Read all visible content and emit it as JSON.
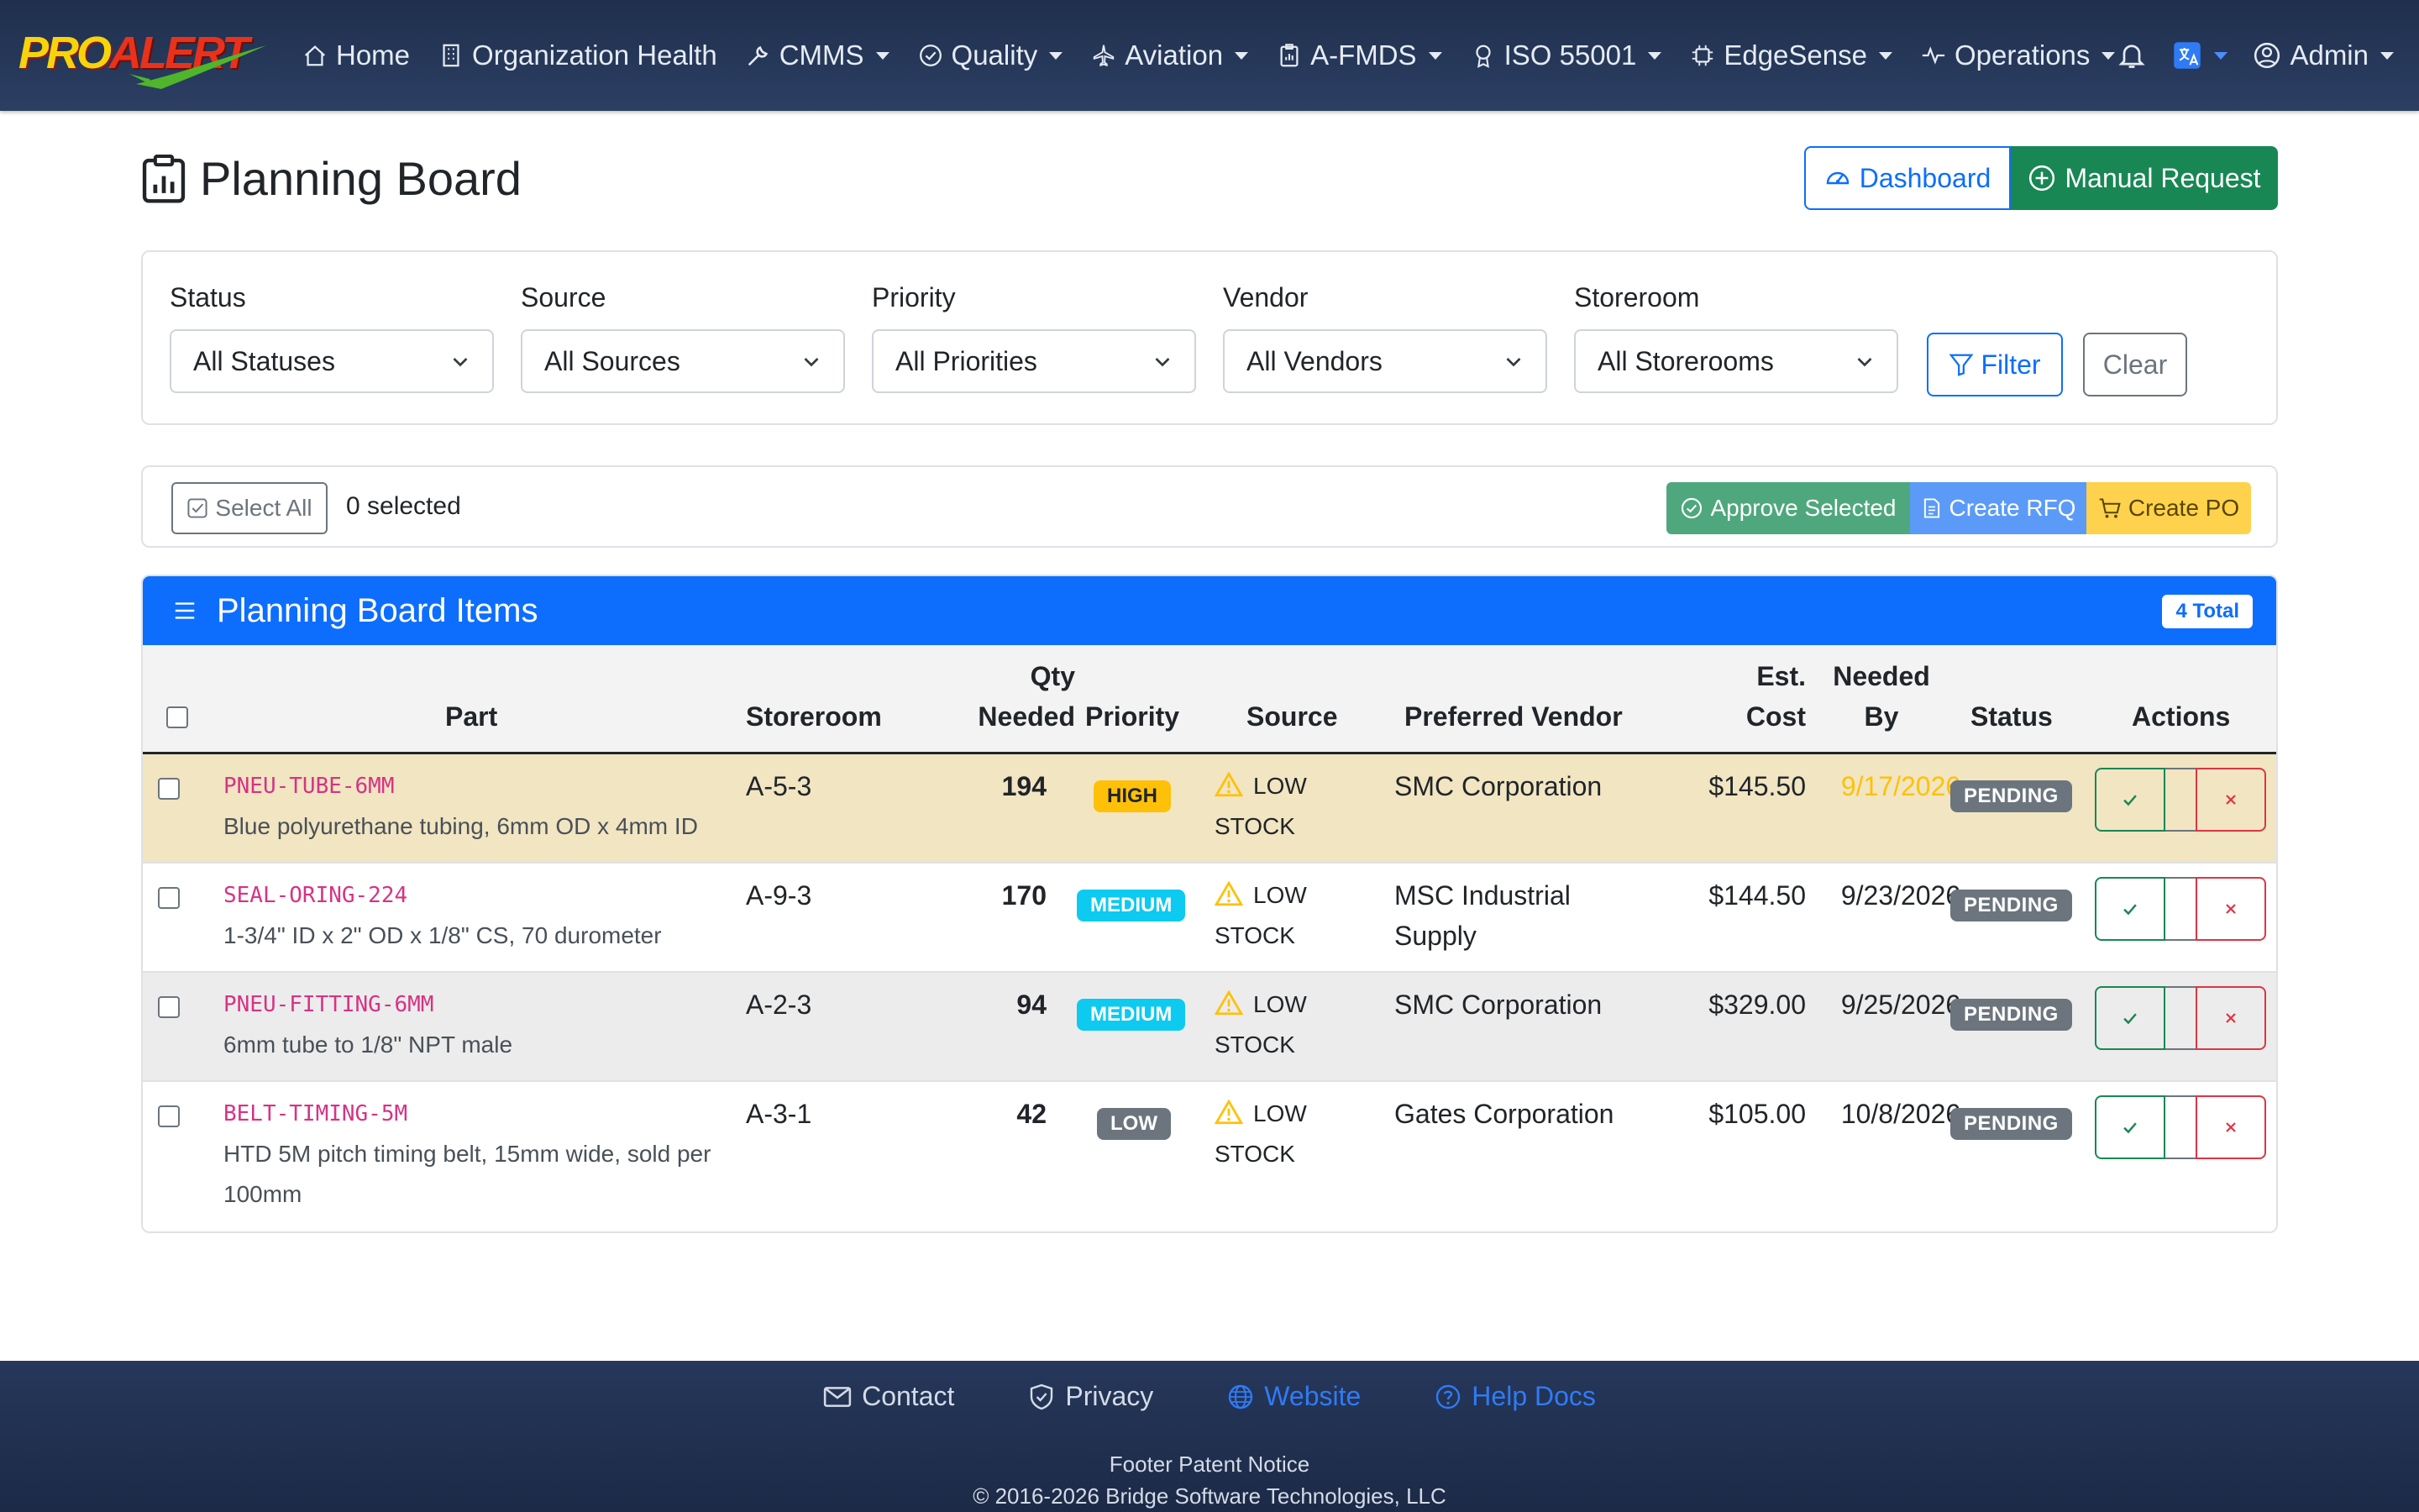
{
  "brand": {
    "pro": "PRO",
    "alert": "ALERT"
  },
  "nav": {
    "home": "Home",
    "org_health": "Organization Health",
    "cmms": "CMMS",
    "quality": "Quality",
    "aviation": "Aviation",
    "afmds": "A-FMDS",
    "iso": "ISO 55001",
    "edgesense": "EdgeSense",
    "operations": "Operations",
    "admin": "Admin"
  },
  "page": {
    "title": "Planning Board",
    "dashboard_label": "Dashboard",
    "manual_request_label": "Manual Request"
  },
  "filters": {
    "status_label": "Status",
    "status_value": "All Statuses",
    "source_label": "Source",
    "source_value": "All Sources",
    "priority_label": "Priority",
    "priority_value": "All Priorities",
    "vendor_label": "Vendor",
    "vendor_value": "All Vendors",
    "storeroom_label": "Storeroom",
    "storeroom_value": "All Storerooms",
    "filter_label": "Filter",
    "clear_label": "Clear"
  },
  "bulk": {
    "select_all_label": "Select All",
    "selected_count": "0 selected",
    "approve_label": "Approve Selected",
    "rfq_label": "Create RFQ",
    "po_label": "Create PO"
  },
  "items": {
    "title": "Planning Board Items",
    "total_badge": "4 Total",
    "columns": {
      "part": "Part",
      "storeroom": "Storeroom",
      "qty_1": "Qty",
      "qty_2": "Needed",
      "priority": "Priority",
      "source": "Source",
      "vendor": "Preferred Vendor",
      "cost_1": "Est.",
      "cost_2": "Cost",
      "needed_1": "Needed",
      "needed_2": "By",
      "status": "Status",
      "actions": "Actions"
    },
    "rows": [
      {
        "code": "PNEU-TUBE-6MM",
        "desc": "Blue polyurethane tubing, 6mm OD x 4mm ID",
        "storeroom": "A-5-3",
        "qty": "194",
        "priority": "HIGH",
        "source_1": "LOW",
        "source_2": "STOCK",
        "vendor": "SMC Corporation",
        "cost": "$145.50",
        "needed_by": "9/17/2026",
        "status": "PENDING"
      },
      {
        "code": "SEAL-ORING-224",
        "desc": "1-3/4\" ID x 2\" OD x 1/8\" CS, 70 durometer",
        "storeroom": "A-9-3",
        "qty": "170",
        "priority": "MEDIUM",
        "source_1": "LOW",
        "source_2": "STOCK",
        "vendor_1": "MSC Industrial",
        "vendor_2": "Supply",
        "cost": "$144.50",
        "needed_by": "9/23/2026",
        "status": "PENDING"
      },
      {
        "code": "PNEU-FITTING-6MM",
        "desc": "6mm tube to 1/8\" NPT male",
        "storeroom": "A-2-3",
        "qty": "94",
        "priority": "MEDIUM",
        "source_1": "LOW",
        "source_2": "STOCK",
        "vendor": "SMC Corporation",
        "cost": "$329.00",
        "needed_by": "9/25/2026",
        "status": "PENDING"
      },
      {
        "code": "BELT-TIMING-5M",
        "desc_1": "HTD 5M pitch timing belt, 15mm wide, sold per",
        "desc_2": "100mm",
        "storeroom": "A-3-1",
        "qty": "42",
        "priority": "LOW",
        "source_1": "LOW",
        "source_2": "STOCK",
        "vendor": "Gates Corporation",
        "cost": "$105.00",
        "needed_by": "10/8/2026",
        "status": "PENDING"
      }
    ]
  },
  "footer": {
    "contact": "Contact",
    "privacy": "Privacy",
    "website": "Website",
    "help_docs": "Help Docs",
    "notice": "Footer Patent Notice",
    "copyright": "© 2016-2026 Bridge Software Technologies, LLC"
  },
  "colors": {
    "navbar": "#26375a",
    "primary": "#0d6efd",
    "success": "#198754",
    "warning": "#ffc107",
    "info": "#0dcaf0",
    "secondary": "#6c757d",
    "danger": "#dc3545",
    "highlight_row": "#f1e5c2"
  },
  "icons": {
    "home": "house-icon",
    "org_health": "building-icon",
    "cmms": "wrench-icon",
    "quality": "check-circle-icon",
    "aviation": "airplane-icon",
    "afmds": "clipboard-icon",
    "iso": "award-icon",
    "edgesense": "chip-icon",
    "operations": "activity-icon",
    "notifications": "bell-icon",
    "language": "translate-icon",
    "admin": "user-circle-icon",
    "page_title": "clipboard-data-icon",
    "dashboard": "speedometer-icon",
    "manual_request": "plus-circle-icon",
    "filter": "funnel-icon",
    "select_all": "check-square-icon",
    "approve": "check-circle-icon",
    "rfq": "file-text-icon",
    "po": "cart-icon",
    "list": "list-icon",
    "warning": "warning-triangle-icon",
    "approve_row": "check-icon",
    "reject_row": "x-icon",
    "contact": "envelope-icon",
    "privacy": "shield-check-icon",
    "website": "globe-icon",
    "help": "question-circle-icon"
  }
}
